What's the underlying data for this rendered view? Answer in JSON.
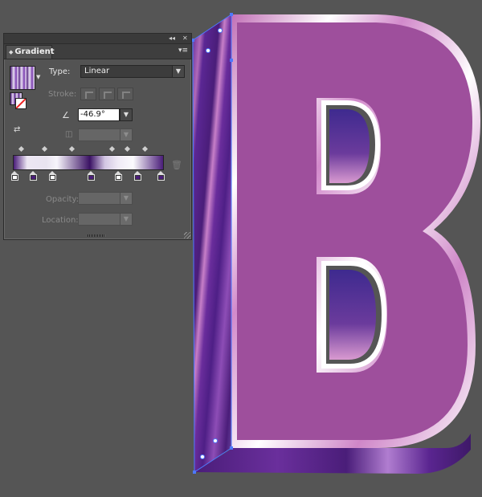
{
  "panel": {
    "tab_title": "Gradient",
    "collapse_glyph": "◂◂",
    "close_glyph": "✕",
    "menu_glyph": "▾≡",
    "type_label": "Type:",
    "type_value": "Linear",
    "stroke_label": "Stroke:",
    "angle_value": "-46.9°",
    "opacity_label": "Opacity:",
    "location_label": "Location:",
    "gradient_stops": [
      {
        "color": "#ffffff"
      },
      {
        "color": "#4a1d79"
      },
      {
        "color": "#ffffff"
      },
      {
        "color": "#4a1d79"
      },
      {
        "color": "#ffffff"
      },
      {
        "color": "#4a1d79"
      },
      {
        "color": "#4a1d79"
      }
    ]
  },
  "artwork": {
    "letter": "B",
    "face_color": "#9e4f9c",
    "edge_color": "#4e1d86",
    "highlight_color": "#ffffff"
  },
  "icons": {
    "gradient_swatch": "gradient-swatch-icon",
    "reverse": "reverse-gradient-icon",
    "angle": "angle-icon",
    "aspect": "aspect-ratio-icon",
    "trash": "trash-icon"
  }
}
